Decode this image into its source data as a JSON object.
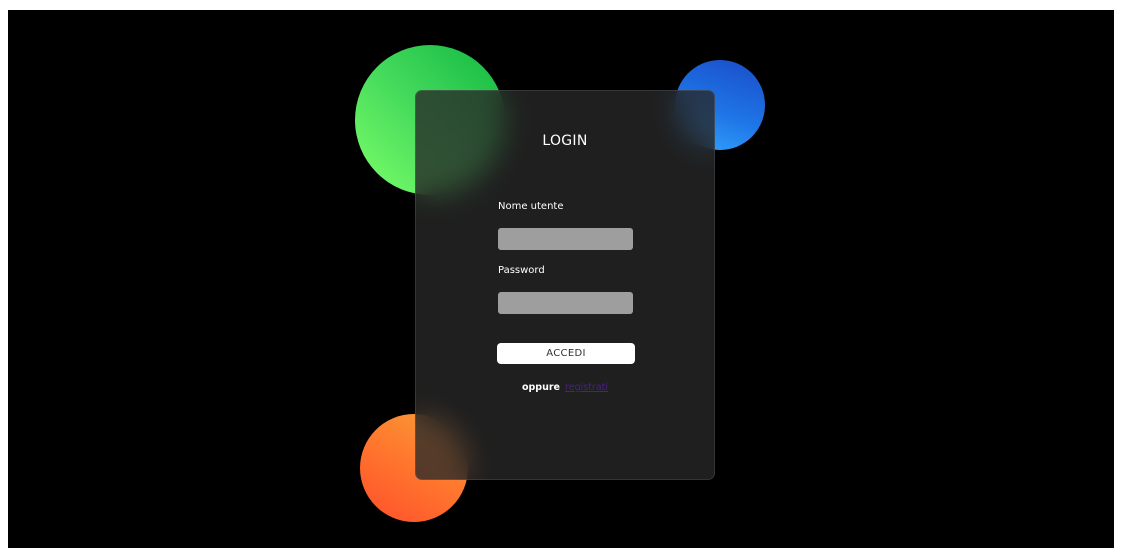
{
  "colors": {
    "background": "#000000",
    "card": "#2a2a2a",
    "ball_green": "#3fd65a",
    "ball_blue": "#1e74e6",
    "ball_orange": "#ff6a2c",
    "input_fill": "#9e9e9e",
    "button_fill": "#ffffff",
    "link": "#4b1f8c"
  },
  "login": {
    "title": "LOGIN",
    "username_label": "Nome utente",
    "username_value": "",
    "password_label": "Password",
    "password_value": "",
    "submit_label": "ACCEDI",
    "alt_prefix": "oppure",
    "register_link": "registrati"
  }
}
